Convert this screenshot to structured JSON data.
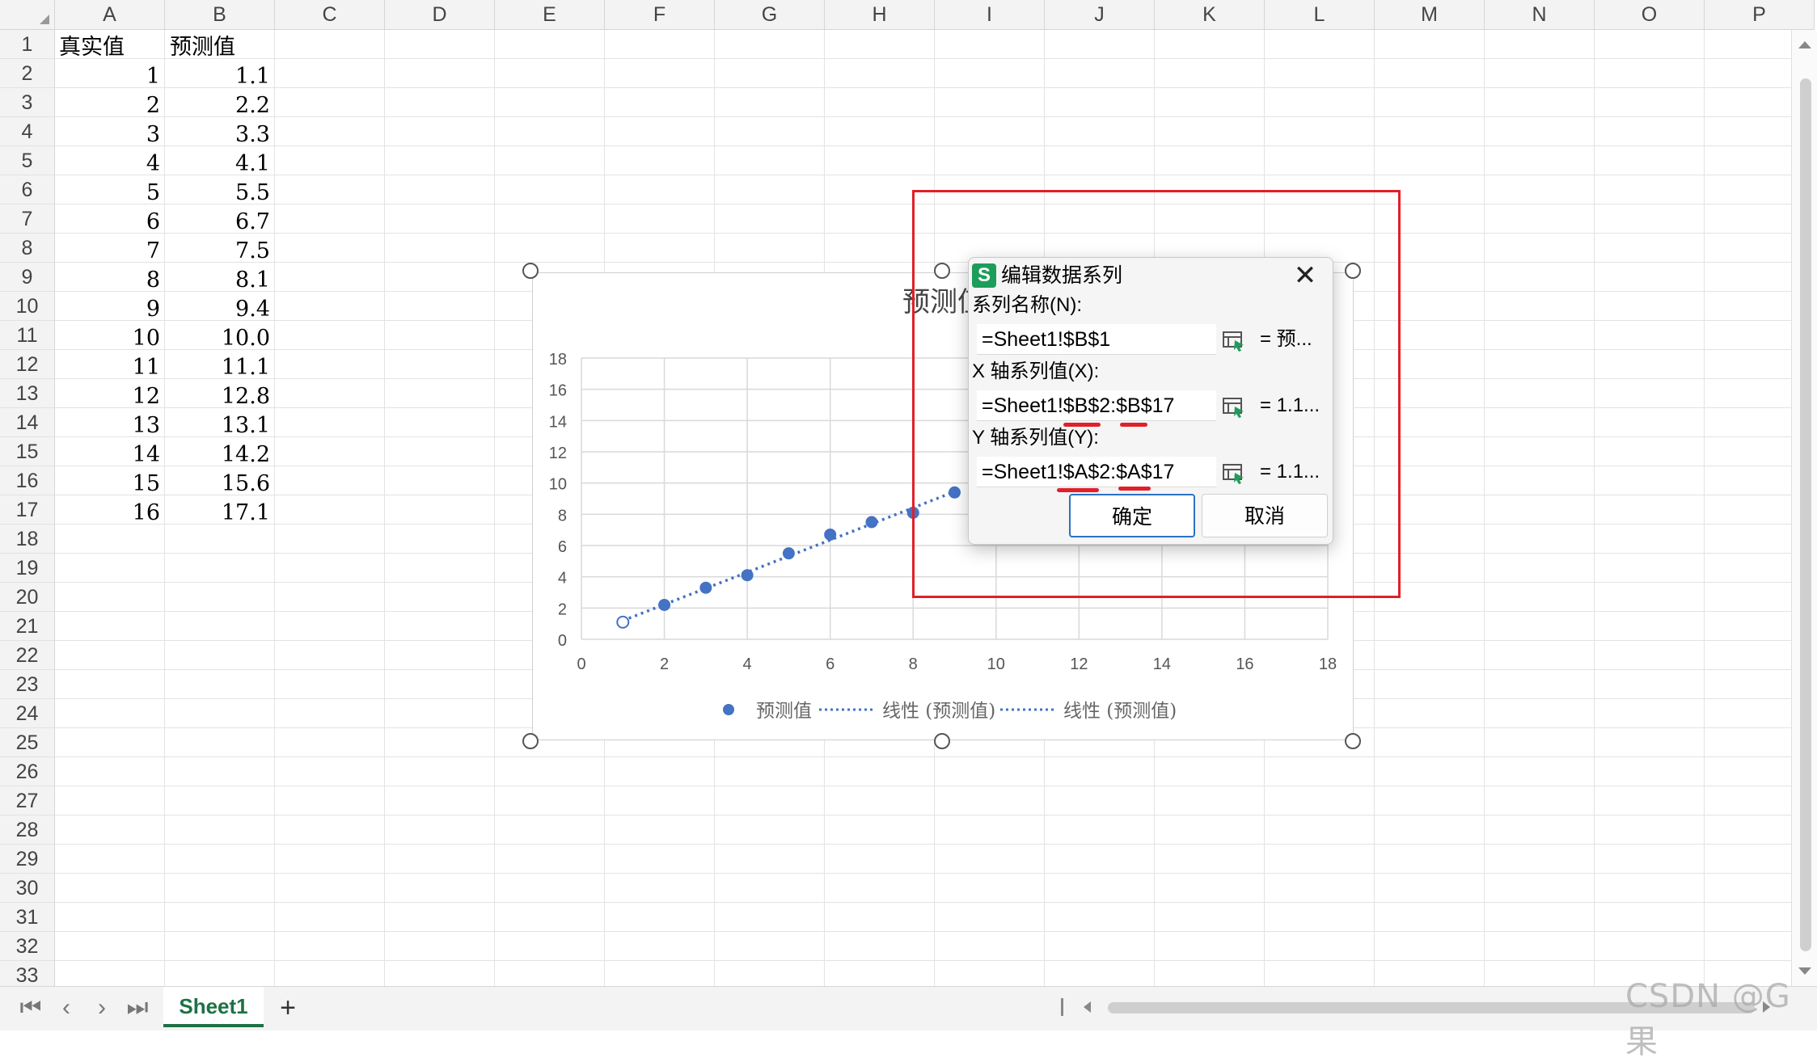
{
  "sheet": {
    "columns": [
      "A",
      "B",
      "C",
      "D",
      "E",
      "F",
      "G",
      "H",
      "I",
      "J",
      "K",
      "L",
      "M",
      "N",
      "O",
      "P"
    ],
    "rows": [
      "1",
      "2",
      "3",
      "4",
      "5",
      "6",
      "7",
      "8",
      "9",
      "10",
      "11",
      "12",
      "13",
      "14",
      "15",
      "16",
      "17",
      "18",
      "19",
      "20",
      "21",
      "22",
      "23",
      "24",
      "25",
      "26",
      "27",
      "28",
      "29",
      "30",
      "31",
      "32",
      "33"
    ],
    "header_a": "真实值",
    "header_b": "预测值",
    "actual_values": [
      "1",
      "2",
      "3",
      "4",
      "5",
      "6",
      "7",
      "8",
      "9",
      "10",
      "11",
      "12",
      "13",
      "14",
      "15",
      "16"
    ],
    "predicted_values": [
      "1.1",
      "2.2",
      "3.3",
      "4.1",
      "5.5",
      "6.7",
      "7.5",
      "8.1",
      "9.4",
      "10.0",
      "11.1",
      "12.8",
      "13.1",
      "14.2",
      "15.6",
      "17.1"
    ]
  },
  "chart": {
    "title": "预测值",
    "legend": [
      "预测值",
      "线性 (预测值)",
      "线性 (预测值)"
    ],
    "series_color": "#4472c4"
  },
  "chart_data": {
    "type": "scatter",
    "title": "预测值",
    "x": [
      1,
      2,
      3,
      4,
      5,
      6,
      7,
      8,
      9
    ],
    "y": [
      1.1,
      2.2,
      3.3,
      4.1,
      5.5,
      6.7,
      7.5,
      8.1,
      9.4
    ],
    "x_ticks": [
      "0",
      "2",
      "4",
      "6",
      "8",
      "10",
      "12",
      "14",
      "16",
      "18"
    ],
    "y_ticks": [
      "0",
      "2",
      "4",
      "6",
      "8",
      "10",
      "12",
      "14",
      "16",
      "18"
    ],
    "xlim": [
      0,
      18
    ],
    "ylim": [
      0,
      18
    ],
    "grid": true,
    "trendline": "linear",
    "legend_placement": "bottom",
    "legend": [
      "预测值",
      "线性 (预测值)",
      "线性 (预测值)"
    ]
  },
  "dialog": {
    "icon_letter": "S",
    "title": "编辑数据系列",
    "name_label": "系列名称(N):",
    "name_ref": "=Sheet1!$B$1",
    "name_value": "= 预...",
    "x_label": "X 轴系列值(X):",
    "x_ref": "=Sheet1!$B$2:$B$17",
    "x_value": "= 1.1...",
    "y_label": "Y 轴系列值(Y):",
    "y_ref": "=Sheet1!$A$2:$A$17",
    "y_value": "= 1.1...",
    "ok_label": "确定",
    "cancel_label": "取消"
  },
  "tabs": {
    "sheet1": "Sheet1",
    "add": "+"
  },
  "watermark": "CSDN @G果",
  "accent_color": "#1e7145",
  "annotation_color": "#e0202a"
}
